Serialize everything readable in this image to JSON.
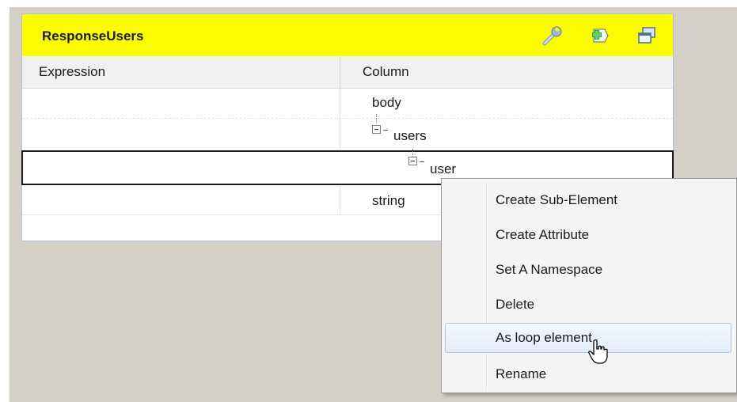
{
  "panel": {
    "title": "ResponseUsers",
    "header_color": "#fcfc00",
    "icons": [
      "wrench-icon",
      "add-arrow-icon",
      "window-icon"
    ]
  },
  "columns": {
    "expression": "Expression",
    "column": "Column"
  },
  "tree": {
    "body": "body",
    "users": "users",
    "user": "user",
    "string": "string"
  },
  "context_menu": {
    "items": [
      {
        "label": "Create Sub-Element"
      },
      {
        "label": "Create Attribute"
      },
      {
        "label": "Set A Namespace"
      },
      {
        "label": "Delete"
      },
      {
        "label": "As loop element",
        "highlighted": true
      },
      {
        "label": "Rename"
      }
    ]
  }
}
